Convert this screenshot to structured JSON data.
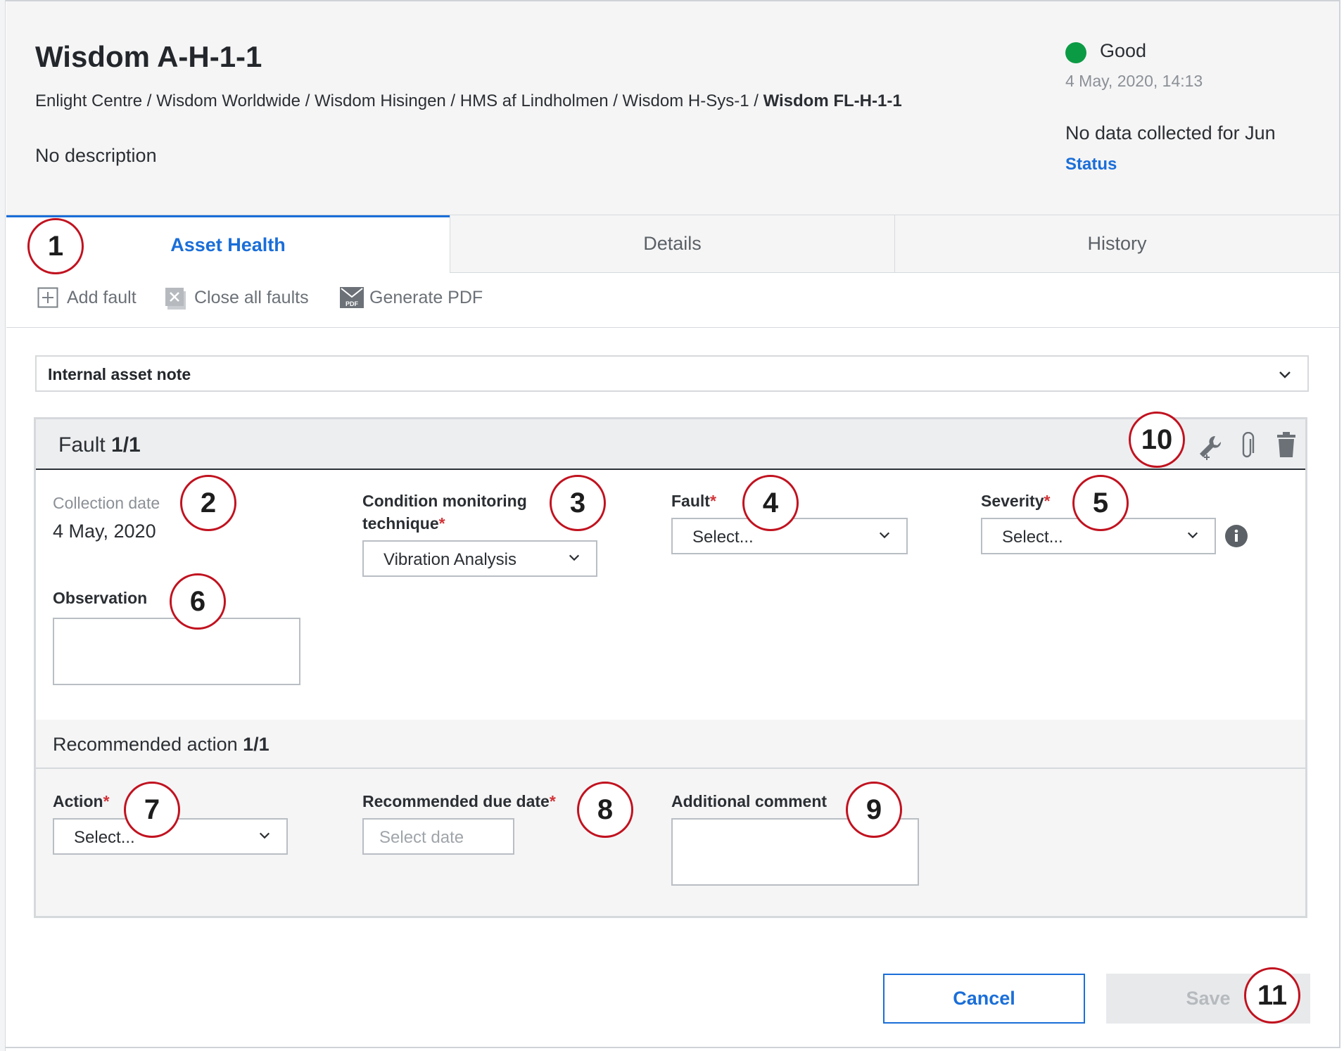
{
  "asset": {
    "title": "Wisdom A-H-1-1",
    "breadcrumb_path": "Enlight Centre / Wisdom Worldwide / Wisdom Hisingen / HMS af Lindholmen / Wisdom H-Sys-1 / ",
    "breadcrumb_last": "Wisdom FL-H-1-1",
    "description": "No description"
  },
  "status": {
    "label": "Good",
    "color": "#0c9b45",
    "timestamp": "4 May, 2020, 14:13",
    "no_data": "No data collected for Jun",
    "link": "Status"
  },
  "tabs": [
    {
      "label": "Asset Health",
      "active": true
    },
    {
      "label": "Details",
      "active": false
    },
    {
      "label": "History",
      "active": false
    }
  ],
  "toolbar": {
    "add_fault": "Add fault",
    "close_all": "Close all faults",
    "generate_pdf": "Generate PDF"
  },
  "internal_note": {
    "label": "Internal asset note"
  },
  "fault": {
    "title_prefix": "Fault ",
    "title_count": "1/1",
    "collection_date_label": "Collection date",
    "collection_date_value": "4 May, 2020",
    "technique_label_line1": "Condition monitoring",
    "technique_label_line2": "technique",
    "technique_value": "Vibration Analysis",
    "fault_label": "Fault",
    "fault_placeholder": "Select...",
    "severity_label": "Severity",
    "severity_placeholder": "Select...",
    "observation_label": "Observation",
    "required_mark": "*"
  },
  "recommended_action": {
    "title_prefix": "Recommended action ",
    "title_count": "1/1",
    "action_label": "Action",
    "action_placeholder": "Select...",
    "due_date_label": "Recommended due date",
    "due_date_placeholder": "Select date",
    "comment_label": "Additional comment"
  },
  "buttons": {
    "cancel": "Cancel",
    "save": "Save"
  },
  "callouts": [
    "1",
    "2",
    "3",
    "4",
    "5",
    "6",
    "7",
    "8",
    "9",
    "10",
    "11"
  ],
  "colors": {
    "accent": "#1a6ed8",
    "callout_border": "#c1121f",
    "required": "#d13438"
  }
}
